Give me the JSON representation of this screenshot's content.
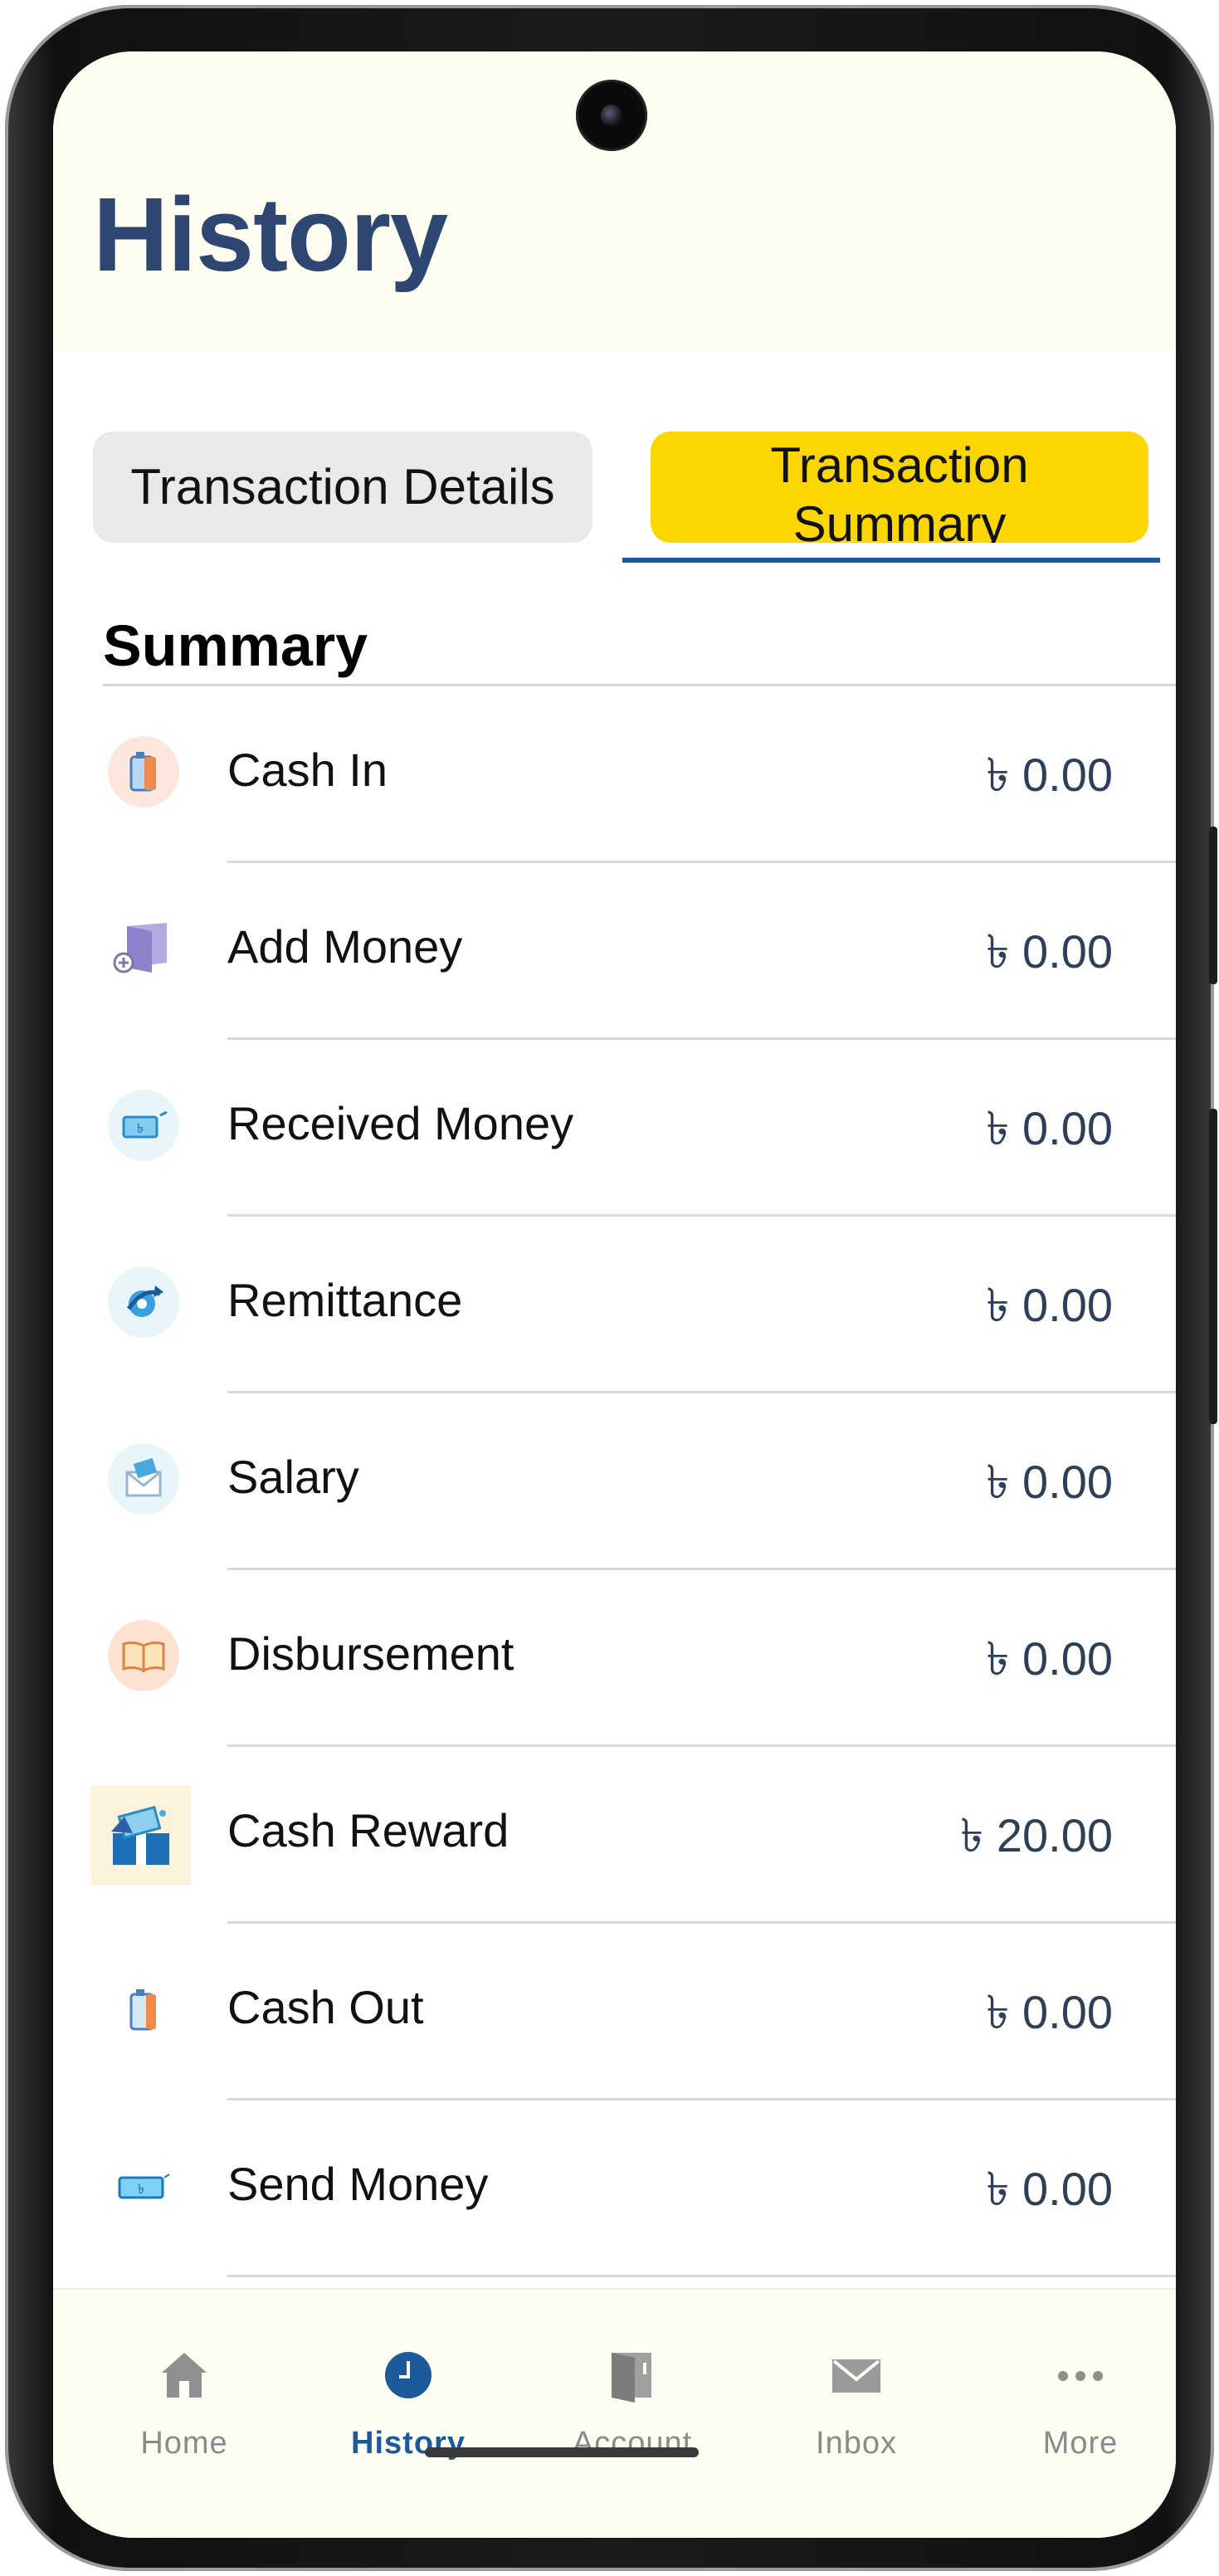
{
  "header": {
    "title": "History"
  },
  "tabs": [
    {
      "label": "Transaction Details",
      "active": false
    },
    {
      "label": "Transaction Summary",
      "active": true
    }
  ],
  "summary": {
    "title": "Summary",
    "rows": [
      {
        "label": "Cash In",
        "amount": "৳ 0.00",
        "icon": "cash-in-icon"
      },
      {
        "label": "Add Money",
        "amount": "৳ 0.00",
        "icon": "add-money-icon"
      },
      {
        "label": "Received Money",
        "amount": "৳ 0.00",
        "icon": "received-money-icon"
      },
      {
        "label": "Remittance",
        "amount": "৳ 0.00",
        "icon": "remittance-icon"
      },
      {
        "label": "Salary",
        "amount": "৳ 0.00",
        "icon": "salary-icon"
      },
      {
        "label": "Disbursement",
        "amount": "৳ 0.00",
        "icon": "disbursement-icon"
      },
      {
        "label": "Cash Reward",
        "amount": "৳ 20.00",
        "icon": "cash-reward-icon"
      },
      {
        "label": "Cash Out",
        "amount": "৳ 0.00",
        "icon": "cash-out-icon"
      },
      {
        "label": "Send Money",
        "amount": "৳ 0.00",
        "icon": "send-money-icon"
      }
    ]
  },
  "bottom_nav": {
    "items": [
      {
        "label": "Home",
        "icon": "home-icon",
        "active": false
      },
      {
        "label": "History",
        "icon": "clock-icon",
        "active": true
      },
      {
        "label": "Account",
        "icon": "account-book-icon",
        "active": false
      },
      {
        "label": "Inbox",
        "icon": "envelope-icon",
        "active": false
      },
      {
        "label": "More",
        "icon": "more-dots-icon",
        "active": false
      }
    ]
  },
  "colors": {
    "title": "#2d4770",
    "active_tab": "#fcd600",
    "accent": "#1d5a9c",
    "header_bg": "#fefdf2"
  }
}
